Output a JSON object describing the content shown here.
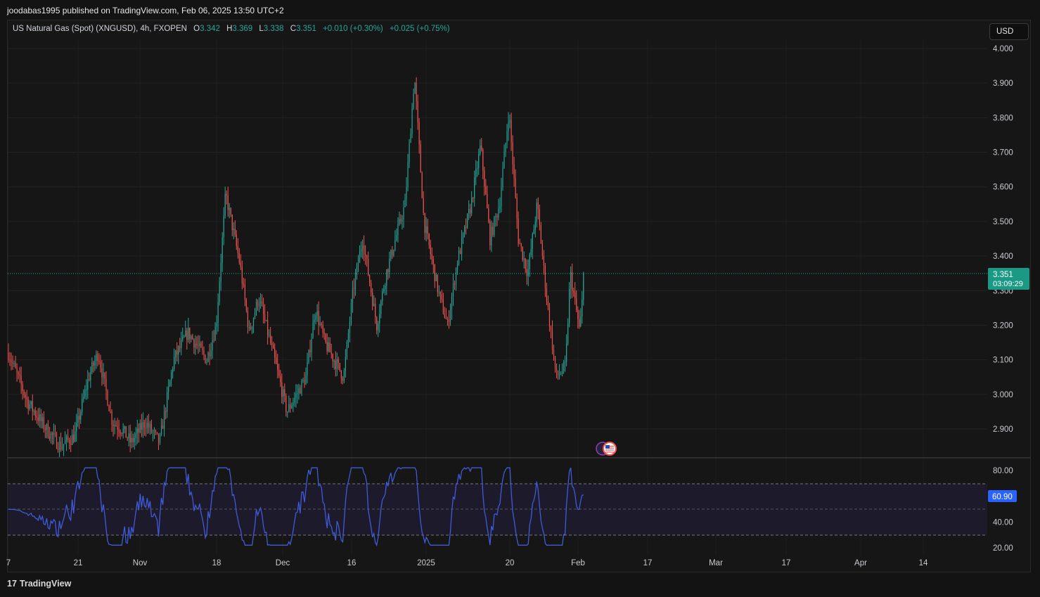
{
  "publisher_line": "joodabas1995 published on TradingView.com, Feb 06, 2025 13:50 UTC+2",
  "legend": {
    "symbol": "US Natural Gas (Spot) (XNGUSD), 4h, FXOPEN",
    "o_label": "O",
    "o_value": "3.342",
    "h_label": "H",
    "h_value": "3.369",
    "l_label": "L",
    "l_value": "3.338",
    "c_label": "C",
    "c_value": "3.351",
    "change": "+0.010 (+0.30%)",
    "change2": "+0.025 (+0.75%)"
  },
  "currency_button": "USD",
  "brand": {
    "logo": "17",
    "name": "TradingView"
  },
  "colors": {
    "up": "#26a69a",
    "down": "#ef5350",
    "rsi": "#3f5bd8",
    "price_tag": "#1a9985",
    "rsi_tag": "#2962ff"
  },
  "chart_data": [
    {
      "type": "candlestick",
      "price_axis": {
        "ticks": [
          "4.000",
          "3.900",
          "3.800",
          "3.700",
          "3.600",
          "3.500",
          "3.400",
          "3.300",
          "3.200",
          "3.100",
          "3.000",
          "2.900"
        ],
        "ylim": [
          2.82,
          4.08
        ]
      },
      "time_axis": {
        "ticks": [
          "7",
          "21",
          "Nov",
          "18",
          "Dec",
          "16",
          "2025",
          "20",
          "Feb",
          "17",
          "Mar",
          "17",
          "Apr",
          "14"
        ]
      },
      "last_price": "3.351",
      "countdown": "03:09:29",
      "path": [
        [
          "Oct 7",
          3.12
        ],
        [
          "Oct 11",
          2.98
        ],
        [
          "Oct 15",
          2.9
        ],
        [
          "Oct 18",
          2.85
        ],
        [
          "Oct 21",
          2.88
        ],
        [
          "Oct 24",
          3.05
        ],
        [
          "Oct 26",
          3.12
        ],
        [
          "Oct 29",
          2.92
        ],
        [
          "Oct 31",
          2.9
        ],
        [
          "Nov 2",
          2.86
        ],
        [
          "Nov 5",
          2.92
        ],
        [
          "Nov 8",
          2.86
        ],
        [
          "Nov 11",
          3.1
        ],
        [
          "Nov 14",
          3.18
        ],
        [
          "Nov 18",
          3.1
        ],
        [
          "Nov 20",
          3.2
        ],
        [
          "Nov 22",
          3.58
        ],
        [
          "Nov 25",
          3.38
        ],
        [
          "Nov 27",
          3.18
        ],
        [
          "Nov 29",
          3.28
        ],
        [
          "Dec 2",
          3.12
        ],
        [
          "Dec 5",
          2.95
        ],
        [
          "Dec 9",
          3.05
        ],
        [
          "Dec 11",
          3.25
        ],
        [
          "Dec 13",
          3.15
        ],
        [
          "Dec 17",
          3.05
        ],
        [
          "Dec 19",
          3.3
        ],
        [
          "Dec 21",
          3.45
        ],
        [
          "Dec 24",
          3.2
        ],
        [
          "Dec 26",
          3.35
        ],
        [
          "Dec 30",
          3.55
        ],
        [
          "Jan 1",
          3.92
        ],
        [
          "Jan 3",
          3.5
        ],
        [
          "Jan 6",
          3.3
        ],
        [
          "Jan 8",
          3.2
        ],
        [
          "Jan 10",
          3.38
        ],
        [
          "Jan 13",
          3.55
        ],
        [
          "Jan 15",
          3.72
        ],
        [
          "Jan 17",
          3.45
        ],
        [
          "Jan 19",
          3.55
        ],
        [
          "Jan 21",
          3.82
        ],
        [
          "Jan 23",
          3.45
        ],
        [
          "Jan 25",
          3.35
        ],
        [
          "Jan 27",
          3.55
        ],
        [
          "Jan 29",
          3.28
        ],
        [
          "Jan 31",
          3.05
        ],
        [
          "Feb 2",
          3.08
        ],
        [
          "Feb 3",
          3.35
        ],
        [
          "Feb 5",
          3.18
        ],
        [
          "Feb 6",
          3.351
        ]
      ]
    },
    {
      "type": "line",
      "name": "",
      "y_axis": {
        "ticks": [
          "80.00",
          "40.00",
          "20.00"
        ],
        "ylim": [
          15,
          85
        ],
        "bands": [
          30,
          50,
          70
        ]
      },
      "last_value": "60.90"
    }
  ]
}
